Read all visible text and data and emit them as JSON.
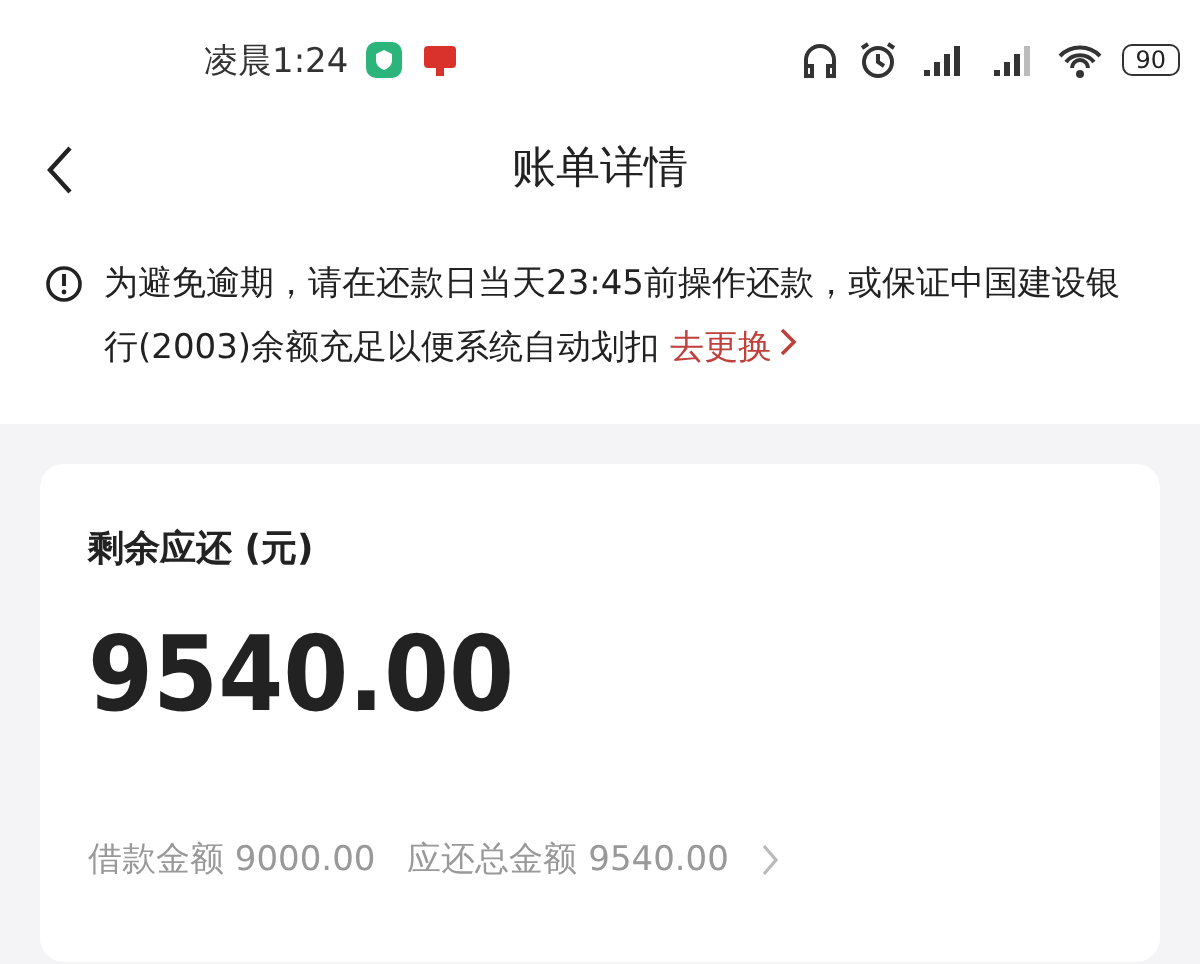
{
  "status_bar": {
    "time": "凌晨1:24",
    "battery": "90"
  },
  "header": {
    "title": "账单详情"
  },
  "notice": {
    "text": "为避免逾期，请在还款日当天23:45前操作还款，或保证中国建设银行(2003)余额充足以便系统自动划扣",
    "link": "去更换"
  },
  "card": {
    "label": "剩余应还 (元)",
    "amount": "9540.00",
    "details": [
      {
        "label": "借款金额",
        "value": "9000.00"
      },
      {
        "label": "应还总金额",
        "value": "9540.00"
      }
    ]
  }
}
